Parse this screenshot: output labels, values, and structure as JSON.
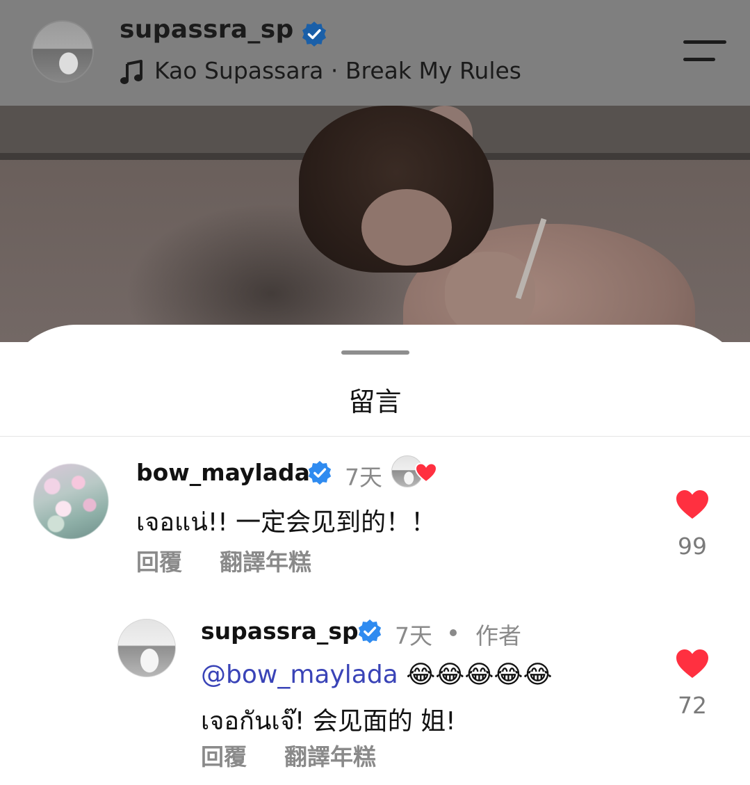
{
  "header": {
    "username": "supassra_sp",
    "music": "Kao Supassara · Break My Rules",
    "icons": {
      "verified": "verified-badge-icon",
      "music": "music-note-icon",
      "menu": "menu-icon"
    }
  },
  "sheet": {
    "title": "留言"
  },
  "comments": [
    {
      "username": "bow_maylada",
      "time": "7天",
      "text": "เจอแน่!!  一定会见到的！！",
      "reply_label": "回覆",
      "translate_label": "翻譯年糕",
      "likes": "99"
    },
    {
      "username": "supassra_sp",
      "time": "7天",
      "author_label": "作者",
      "mention": "@bow_maylada",
      "emojis": "😂😂😂😂😂",
      "text": "เจอกันเจ๊!  会见面的 姐!",
      "reply_label": "回覆",
      "translate_label": "翻譯年糕",
      "likes": "72"
    }
  ],
  "colors": {
    "verified": "#2f8bf0",
    "heart": "#ff3040",
    "mention": "#3943b7",
    "muted": "#8a8a8a"
  }
}
